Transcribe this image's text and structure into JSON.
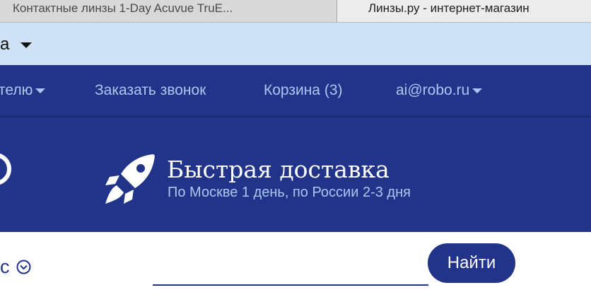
{
  "browser": {
    "tabs": [
      {
        "title": "Контактные линзы 1-Day Acuvue TruE...",
        "active": false
      },
      {
        "title": "Линзы.ру - интернет-магазин",
        "active": true
      }
    ]
  },
  "city_bar": {
    "city": "а"
  },
  "nav": {
    "items": [
      {
        "label": "телю",
        "has_dropdown": true
      },
      {
        "label": "Заказать звонок",
        "has_dropdown": false
      },
      {
        "label": "Корзина (3)",
        "has_dropdown": false
      },
      {
        "label": "ai@robo.ru",
        "has_dropdown": true
      }
    ]
  },
  "hero": {
    "title": "Быстрая доставка",
    "subtitle": "По Москве 1 день, по России 2-3 дня"
  },
  "search": {
    "left_fragment": "с",
    "input_value": "",
    "button_label": "Найти"
  },
  "colors": {
    "brand_blue": "#22348a",
    "light_blue_text": "#a9c7f2",
    "city_bar_bg": "#cfe2f5"
  }
}
